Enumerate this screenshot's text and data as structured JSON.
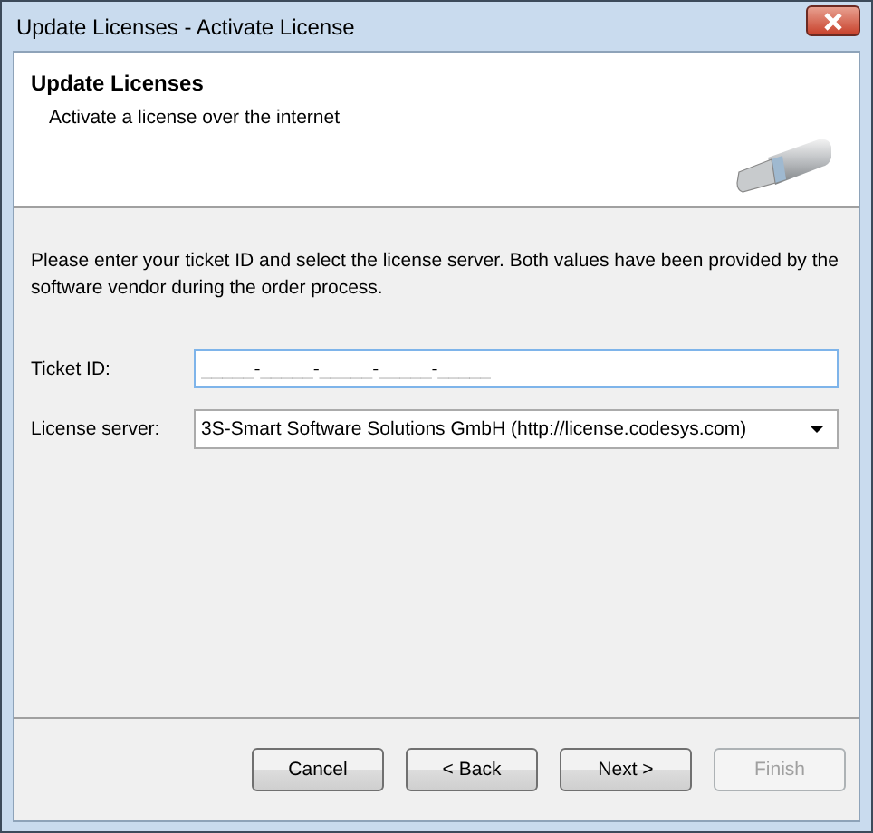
{
  "window": {
    "title": "Update Licenses - Activate License"
  },
  "header": {
    "title": "Update Licenses",
    "subtitle": "Activate a license over the internet"
  },
  "instructions": "Please enter your ticket ID and select the license server. Both values have been provided by the software vendor during the order process.",
  "fields": [
    {
      "kind": "text",
      "label": "Ticket ID:",
      "value": "_____-_____-_____-_____-_____"
    },
    {
      "kind": "dropdown",
      "label": "License server:",
      "value": "3S-Smart Software Solutions GmbH (http://license.codesys.com)"
    }
  ],
  "buttons": [
    {
      "label": "Cancel",
      "disabled": false
    },
    {
      "label": "< Back",
      "disabled": false
    },
    {
      "label": "Next >",
      "disabled": false
    },
    {
      "label": "Finish",
      "disabled": true
    }
  ]
}
